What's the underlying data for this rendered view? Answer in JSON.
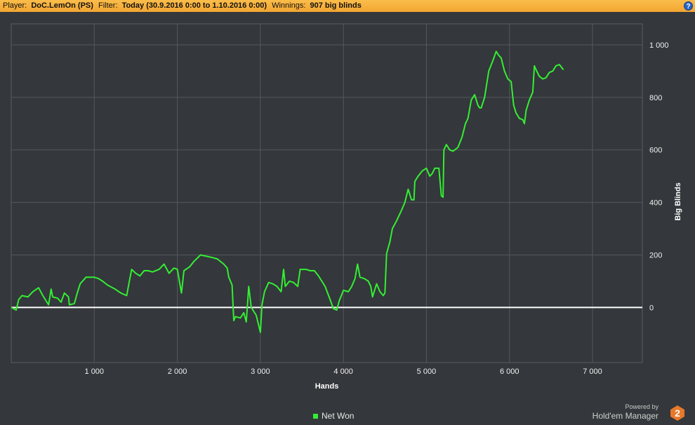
{
  "header": {
    "player_label": "Player:",
    "player_value": "DoC.LemOn (PS)",
    "filter_label": "Filter:",
    "filter_value": "Today (30.9.2016 0:00 to 1.10.2016 0:00)",
    "winnings_label": "Winnings:",
    "winnings_value": "907 big blinds",
    "help_glyph": "?"
  },
  "chart_data": {
    "type": "line",
    "xlabel": "Hands",
    "ylabel": "Big Blinds",
    "xlim": [
      0,
      7600
    ],
    "ylim": [
      -210,
      1080
    ],
    "x_ticks": [
      1000,
      2000,
      3000,
      4000,
      5000,
      6000,
      7000
    ],
    "x_tick_labels": [
      "1 000",
      "2 000",
      "3 000",
      "4 000",
      "5 000",
      "6 000",
      "7 000"
    ],
    "y_ticks": [
      0,
      200,
      400,
      600,
      800,
      1000
    ],
    "y_tick_labels": [
      "0",
      "200",
      "400",
      "600",
      "800",
      "1 000"
    ],
    "grid": true,
    "legend_position": "bottom-center",
    "series_colors": {
      "net_won": "#33ee33",
      "zero_line": "#ffffff"
    },
    "series": [
      {
        "name": "Net Won",
        "points": [
          [
            0,
            0
          ],
          [
            60,
            -10
          ],
          [
            90,
            30
          ],
          [
            130,
            45
          ],
          [
            200,
            40
          ],
          [
            260,
            60
          ],
          [
            330,
            75
          ],
          [
            380,
            45
          ],
          [
            450,
            10
          ],
          [
            480,
            70
          ],
          [
            500,
            40
          ],
          [
            560,
            35
          ],
          [
            600,
            20
          ],
          [
            640,
            55
          ],
          [
            690,
            40
          ],
          [
            700,
            10
          ],
          [
            760,
            15
          ],
          [
            800,
            60
          ],
          [
            830,
            90
          ],
          [
            900,
            115
          ],
          [
            1000,
            115
          ],
          [
            1050,
            110
          ],
          [
            1100,
            100
          ],
          [
            1160,
            85
          ],
          [
            1250,
            70
          ],
          [
            1320,
            55
          ],
          [
            1390,
            45
          ],
          [
            1450,
            145
          ],
          [
            1500,
            130
          ],
          [
            1550,
            120
          ],
          [
            1600,
            140
          ],
          [
            1650,
            140
          ],
          [
            1700,
            135
          ],
          [
            1780,
            145
          ],
          [
            1840,
            165
          ],
          [
            1900,
            130
          ],
          [
            1960,
            150
          ],
          [
            2000,
            145
          ],
          [
            2050,
            55
          ],
          [
            2080,
            140
          ],
          [
            2150,
            155
          ],
          [
            2200,
            175
          ],
          [
            2280,
            200
          ],
          [
            2350,
            195
          ],
          [
            2420,
            190
          ],
          [
            2480,
            185
          ],
          [
            2560,
            165
          ],
          [
            2600,
            150
          ],
          [
            2620,
            115
          ],
          [
            2660,
            85
          ],
          [
            2680,
            -50
          ],
          [
            2700,
            -35
          ],
          [
            2760,
            -40
          ],
          [
            2800,
            -20
          ],
          [
            2830,
            -55
          ],
          [
            2860,
            80
          ],
          [
            2890,
            0
          ],
          [
            2950,
            -30
          ],
          [
            3000,
            -95
          ],
          [
            3020,
            10
          ],
          [
            3050,
            60
          ],
          [
            3100,
            95
          ],
          [
            3150,
            90
          ],
          [
            3200,
            80
          ],
          [
            3250,
            60
          ],
          [
            3280,
            145
          ],
          [
            3300,
            80
          ],
          [
            3350,
            100
          ],
          [
            3400,
            95
          ],
          [
            3450,
            80
          ],
          [
            3480,
            145
          ],
          [
            3550,
            145
          ],
          [
            3600,
            140
          ],
          [
            3650,
            140
          ],
          [
            3700,
            120
          ],
          [
            3780,
            80
          ],
          [
            3840,
            30
          ],
          [
            3880,
            -5
          ],
          [
            3920,
            -10
          ],
          [
            3950,
            25
          ],
          [
            4000,
            65
          ],
          [
            4060,
            60
          ],
          [
            4100,
            80
          ],
          [
            4140,
            110
          ],
          [
            4170,
            165
          ],
          [
            4200,
            115
          ],
          [
            4250,
            110
          ],
          [
            4300,
            100
          ],
          [
            4330,
            80
          ],
          [
            4350,
            40
          ],
          [
            4400,
            90
          ],
          [
            4440,
            60
          ],
          [
            4480,
            45
          ],
          [
            4500,
            55
          ],
          [
            4520,
            205
          ],
          [
            4560,
            250
          ],
          [
            4590,
            300
          ],
          [
            4640,
            330
          ],
          [
            4700,
            370
          ],
          [
            4740,
            400
          ],
          [
            4780,
            450
          ],
          [
            4820,
            410
          ],
          [
            4850,
            410
          ],
          [
            4860,
            480
          ],
          [
            4900,
            500
          ],
          [
            4950,
            520
          ],
          [
            5000,
            530
          ],
          [
            5040,
            500
          ],
          [
            5070,
            510
          ],
          [
            5100,
            530
          ],
          [
            5150,
            530
          ],
          [
            5180,
            425
          ],
          [
            5200,
            420
          ],
          [
            5210,
            600
          ],
          [
            5240,
            620
          ],
          [
            5280,
            600
          ],
          [
            5320,
            595
          ],
          [
            5380,
            610
          ],
          [
            5430,
            650
          ],
          [
            5470,
            700
          ],
          [
            5500,
            720
          ],
          [
            5540,
            790
          ],
          [
            5580,
            810
          ],
          [
            5620,
            770
          ],
          [
            5640,
            760
          ],
          [
            5660,
            760
          ],
          [
            5700,
            800
          ],
          [
            5750,
            900
          ],
          [
            5800,
            940
          ],
          [
            5840,
            975
          ],
          [
            5870,
            960
          ],
          [
            5900,
            950
          ],
          [
            5940,
            900
          ],
          [
            5980,
            870
          ],
          [
            6020,
            860
          ],
          [
            6050,
            770
          ],
          [
            6080,
            740
          ],
          [
            6120,
            720
          ],
          [
            6160,
            715
          ],
          [
            6180,
            700
          ],
          [
            6200,
            750
          ],
          [
            6240,
            790
          ],
          [
            6280,
            820
          ],
          [
            6300,
            920
          ],
          [
            6320,
            905
          ],
          [
            6360,
            880
          ],
          [
            6400,
            870
          ],
          [
            6440,
            875
          ],
          [
            6480,
            895
          ],
          [
            6520,
            900
          ],
          [
            6560,
            920
          ],
          [
            6600,
            925
          ],
          [
            6650,
            905
          ]
        ]
      }
    ]
  },
  "legend": {
    "label": "Net Won"
  },
  "branding": {
    "powered_by": "Powered by",
    "product": "Hold'em Manager",
    "logo_digit": "2",
    "logo_color": "#e8782a"
  }
}
